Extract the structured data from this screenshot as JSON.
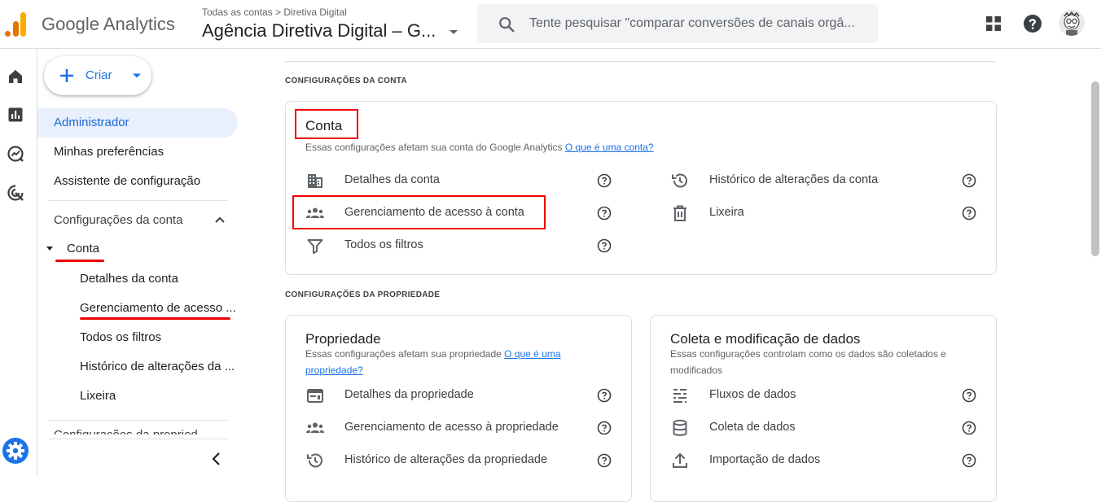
{
  "header": {
    "app_name": "Google Analytics",
    "breadcrumb": "Todas as contas > Diretiva Digital",
    "property_name": "Agência Diretiva Digital – G...",
    "search_placeholder": "Tente pesquisar \"comparar conversões de canais orgâ..."
  },
  "colors": {
    "accent": "#1a73e8",
    "highlight": "#ee0000",
    "active_bg": "#e8f0fe"
  },
  "icons": {
    "header": [
      "apps-grid-icon",
      "help-icon",
      "avatar"
    ],
    "rail": [
      "home-icon",
      "reports-icon",
      "explore-icon",
      "advertising-icon",
      "admin-gear-icon"
    ]
  },
  "sidenav": {
    "create_label": "Criar",
    "items": [
      "Administrador",
      "Minhas preferências",
      "Assistente de configuração"
    ],
    "account_section": "Configurações da conta",
    "account_node": "Conta",
    "account_children": [
      "Detalhes da conta",
      "Gerenciamento de acesso ...",
      "Todos os filtros",
      "Histórico de alterações da ...",
      "Lixeira"
    ],
    "property_section": "Configurações da propried"
  },
  "main": {
    "account_settings_label": "CONFIGURAÇÕES DA CONTA",
    "account_card": {
      "title": "Conta",
      "desc": "Essas configurações afetam sua conta do Google Analytics",
      "link": "O que é uma conta?",
      "left": [
        "Detalhes da conta",
        "Gerenciamento de acesso à conta",
        "Todos os filtros"
      ],
      "right": [
        "Histórico de alterações da conta",
        "Lixeira"
      ]
    },
    "property_settings_label": "CONFIGURAÇÕES DA PROPRIEDADE",
    "property_card": {
      "title": "Propriedade",
      "desc": "Essas configurações afetam sua propriedade",
      "link_part1": "O que é uma",
      "link_part2": "propriedade?",
      "items": [
        "Detalhes da propriedade",
        "Gerenciamento de acesso à propriedade",
        "Histórico de alterações da propriedade"
      ]
    },
    "data_card": {
      "title": "Coleta e modificação de dados",
      "desc1": "Essas configurações controlam como os dados são coletados e",
      "desc2": "modificados",
      "items": [
        "Fluxos de dados",
        "Coleta de dados",
        "Importação de dados"
      ]
    }
  }
}
